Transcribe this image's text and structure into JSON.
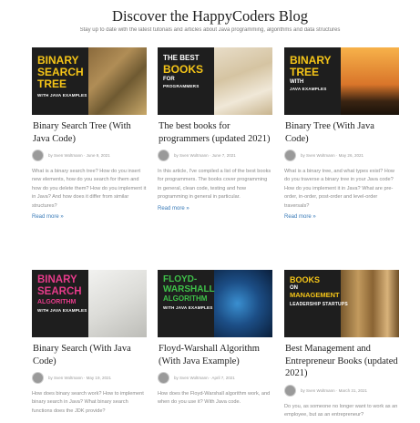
{
  "header": {
    "title": "Discover the HappyCoders Blog",
    "subtitle": "Stay up to date with the latest tutorials and articles about Java programming, algorithms and data structures"
  },
  "colors": {
    "band_dark": "#1e1e1e",
    "tag_yellow": "#f5c518",
    "tag_pink": "#e63b8a",
    "tag_green": "#3fc14a",
    "link": "#3a7bb8"
  },
  "cards": [
    {
      "image": {
        "line1": "BINARY",
        "line2": "SEARCH",
        "line3": "TREE",
        "sub": "WITH JAVA EXAMPLES"
      },
      "title": "Binary Search Tree (With Java Code)",
      "meta": "by Sven Woltmann · June 9, 2021",
      "excerpt": "What is a binary search tree? How do you insert new elements, how do you search for them and how do you delete them? How do you implement it in Java? And how does it differ from similar structures?",
      "read_more": "Read more »"
    },
    {
      "image": {
        "line1": "THE BEST",
        "line2": "BOOKS",
        "line3": "FOR",
        "sub": "PROGRAMMERS"
      },
      "title": "The best books for programmers (updated 2021)",
      "meta": "by Sven Woltmann · June 7, 2021",
      "excerpt": "In this article, I've compiled a list of the best books for programmers. The books cover programming in general, clean code, testing and how programming in general in particular.",
      "read_more": "Read more »"
    },
    {
      "image": {
        "line1": "BINARY",
        "line2": "TREE",
        "line3": "WITH",
        "sub": "JAVA EXAMPLES"
      },
      "title": "Binary Tree (With Java Code)",
      "meta": "by Sven Woltmann · May 26, 2021",
      "excerpt": "What is a binary tree, and what types exist? How do you traverse a binary tree in your Java code? How do you implement it in Java? What are pre-order, in-order, post-order and level-order traversals?",
      "read_more": "Read more »"
    },
    {
      "image": {
        "line1": "BINARY",
        "line2": "SEARCH",
        "line3": "ALGORITHM",
        "sub": "WITH JAVA EXAMPLES"
      },
      "title": "Binary Search (With Java Code)",
      "meta": "by Sven Woltmann · May 19, 2021",
      "excerpt": "How does binary search work? How to implement binary search in Java? What binary search functions does the JDK provide?",
      "read_more": ""
    },
    {
      "image": {
        "line1": "FLOYD-",
        "line2": "WARSHALL",
        "line3": "ALGORITHM",
        "sub": "WITH JAVA EXAMPLES"
      },
      "title": "Floyd-Warshall Algorithm (With Java Example)",
      "meta": "by Sven Woltmann · April 7, 2021",
      "excerpt": "How does the Floyd-Warshall algorithm work, and when do you use it? With Java code.",
      "read_more": ""
    },
    {
      "image": {
        "line1": "BOOKS",
        "line2": "ON",
        "line3": "MANAGEMENT",
        "sub": "LEADERSHIP STARTUPS"
      },
      "title": "Best Management and Entrepreneur Books (updated 2021)",
      "meta": "by Sven Woltmann · March 31, 2021",
      "excerpt": "Do you, as someone no longer want to work as an employee, but as an entrepreneur?",
      "read_more": ""
    }
  ]
}
